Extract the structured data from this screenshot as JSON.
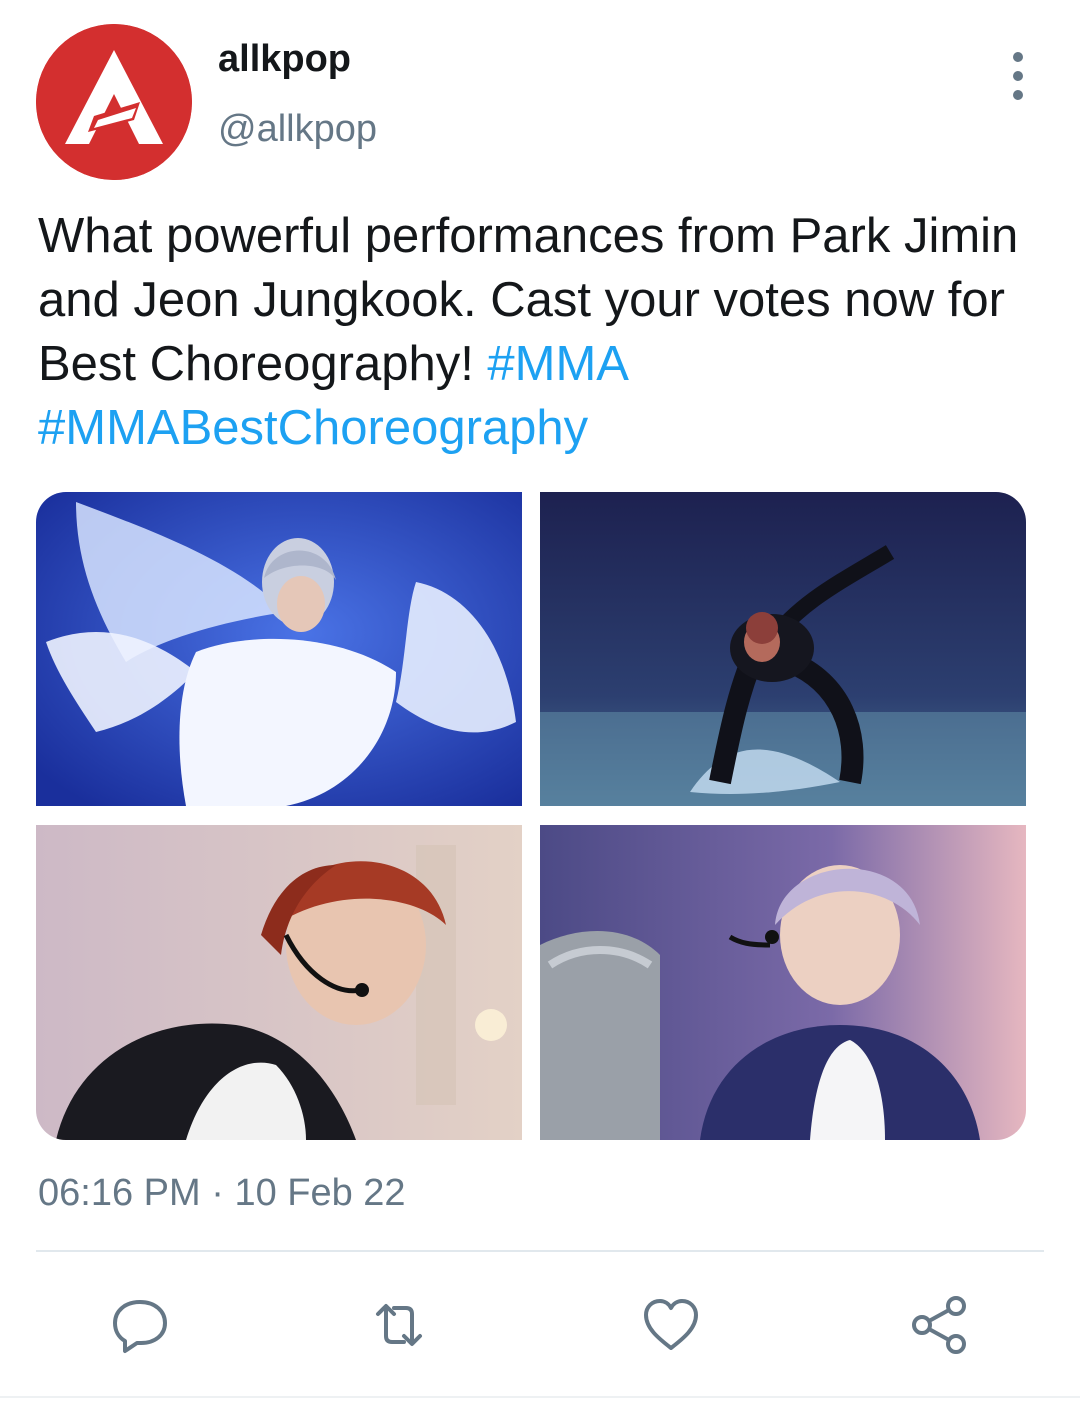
{
  "tweet": {
    "display_name": "allkpop",
    "handle": "@allkpop",
    "text_plain": "What powerful performances from Park Jimin and Jeon Jungkook. Cast your votes now for Best Choreography! ",
    "hashtag_1": "#MMA",
    "hashtag_2": "#MMABestChoreography",
    "time": "06:16 PM",
    "separator": " · ",
    "date": "10 Feb 22"
  },
  "media": [
    {
      "icon": "performer-white-outfit-photo"
    },
    {
      "icon": "performer-dancing-water-photo"
    },
    {
      "icon": "performer-headset-mic-photo"
    },
    {
      "icon": "performer-throne-photo"
    }
  ],
  "actions": [
    {
      "icon": "reply-icon"
    },
    {
      "icon": "retweet-icon"
    },
    {
      "icon": "like-icon"
    },
    {
      "icon": "share-icon"
    }
  ],
  "colors": {
    "accent": "#1da1f2",
    "secondary_text": "#657786",
    "brand_red": "#d32f2f"
  }
}
